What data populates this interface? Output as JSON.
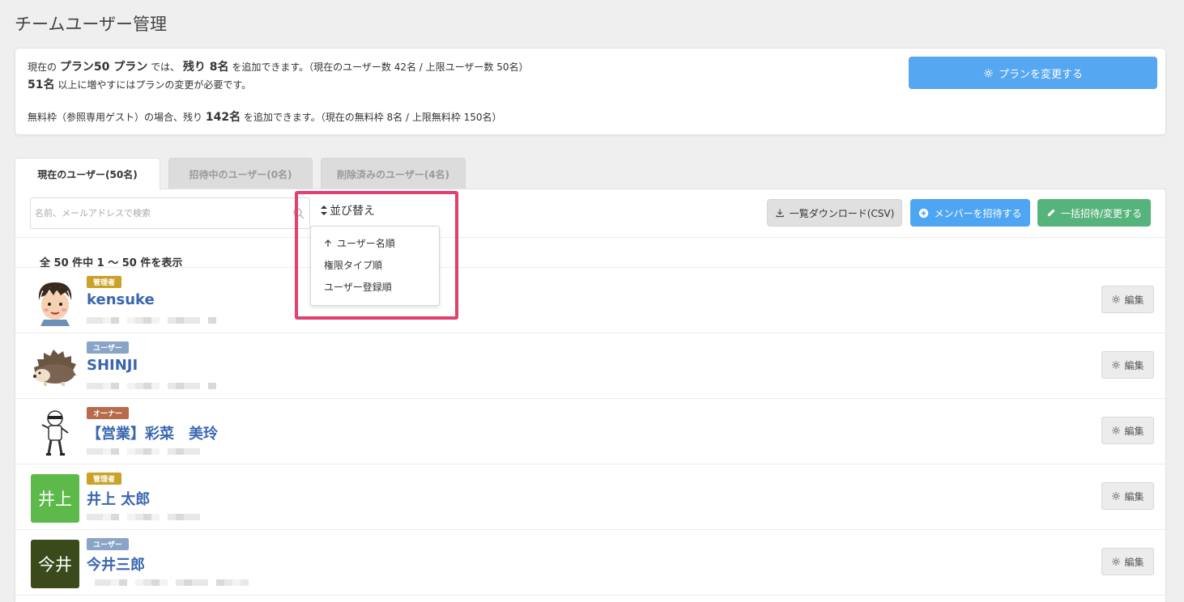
{
  "page": {
    "title": "チームユーザー管理"
  },
  "plan": {
    "line1": {
      "p1": "現在の",
      "plan_name": "プラン50 プラン",
      "p2": "では、",
      "remaining": "残り 8名",
      "p3": "を追加できます。（現在のユーザー数 42名 / 上限ユーザー数 50名）"
    },
    "line2": {
      "threshold": "51名",
      "p1": "以上に増やすにはプランの変更が必要です。"
    },
    "line3": {
      "p1": "無料枠（参照専用ゲスト）の場合、残り",
      "remaining": "142名",
      "p2": "を追加できます。（現在の無料枠 8名 / 上限無料枠 150名）"
    },
    "change_button": "プランを変更する"
  },
  "tabs": [
    {
      "label": "現在のユーザー(50名)",
      "active": true
    },
    {
      "label": "招待中のユーザー(0名)",
      "active": false
    },
    {
      "label": "削除済みのユーザー(4名)",
      "active": false
    }
  ],
  "search": {
    "placeholder": "名前、メールアドレスで検索",
    "value": ""
  },
  "sort": {
    "label": "並び替え",
    "options": [
      {
        "label": "ユーザー名順",
        "selected": true
      },
      {
        "label": "権限タイプ順",
        "selected": false
      },
      {
        "label": "ユーザー登録順",
        "selected": false
      }
    ]
  },
  "toolbar": {
    "csv_label": "一覧ダウンロード(CSV)",
    "invite_label": "メンバーを招待する",
    "bulk_label": "一括招待/変更する"
  },
  "list": {
    "count_text": "全 50 件中 1 〜 50 件を表示",
    "edit_label": "編集",
    "users": [
      {
        "name": "kensuke",
        "role": "管理者",
        "role_color": "#c9a227",
        "avatar_type": "illustration-boy",
        "avatar_text": ""
      },
      {
        "name": "SHINJI",
        "role": "ユーザー",
        "role_color": "#8aa4c8",
        "avatar_type": "illustration-hedgehog",
        "avatar_text": ""
      },
      {
        "name": "【営業】彩菜　美玲",
        "role": "オーナー",
        "role_color": "#b86b4b",
        "avatar_type": "illustration-ninja",
        "avatar_text": ""
      },
      {
        "name": "井上 太郎",
        "role": "管理者",
        "role_color": "#c9a227",
        "avatar_type": "text",
        "avatar_text": "井上",
        "avatar_color": "#5cb94a"
      },
      {
        "name": "今井三郎",
        "role": "ユーザー",
        "role_color": "#8aa4c8",
        "avatar_type": "text",
        "avatar_text": "今井",
        "avatar_color": "#3a4a1a"
      }
    ]
  },
  "colors": {
    "accent_blue": "#55a7f2",
    "accent_green": "#57b37c",
    "highlight": "#e0416e",
    "link": "#3a66b0"
  }
}
